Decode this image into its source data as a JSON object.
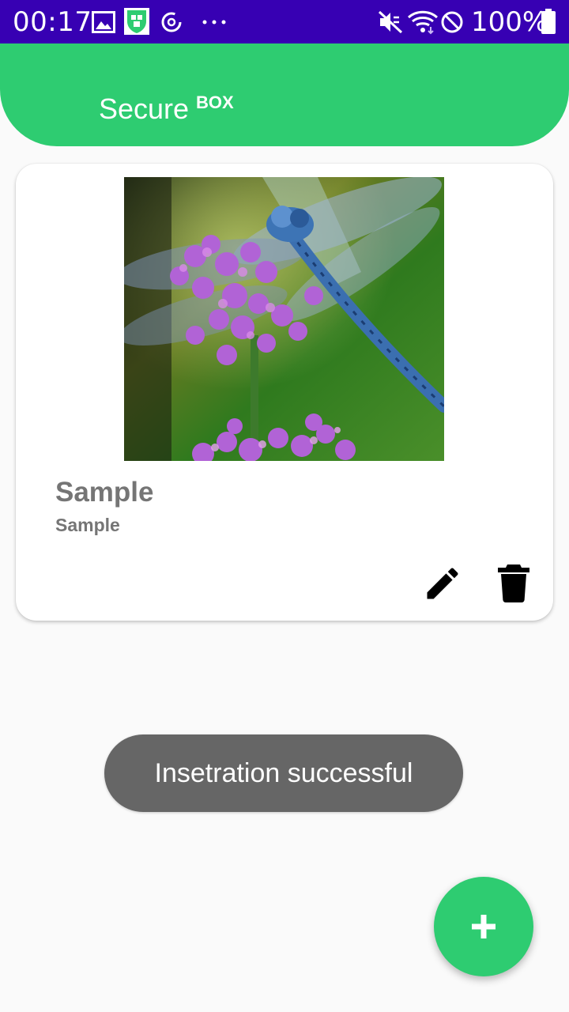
{
  "status_bar": {
    "time": "00:17",
    "battery_text": "100%",
    "left_icons": [
      "image-icon",
      "securebox-app-icon",
      "sync-icon",
      "more-dots-icon"
    ],
    "right_icons": [
      "mute-icon",
      "wifi-icon",
      "do-not-disturb-icon",
      "battery-icon"
    ],
    "background": "#3700b3"
  },
  "header": {
    "title": "Secure",
    "title_superscript": "BOX",
    "background": "#2ecc71"
  },
  "card": {
    "title": "Sample",
    "subtitle": "Sample",
    "image_description_icon": "dragonfly-photo",
    "actions": [
      "edit-icon",
      "delete-icon"
    ]
  },
  "toast": {
    "message": "Insetration successful"
  },
  "fab": {
    "icon": "plus-icon",
    "background": "#2ecc71"
  }
}
